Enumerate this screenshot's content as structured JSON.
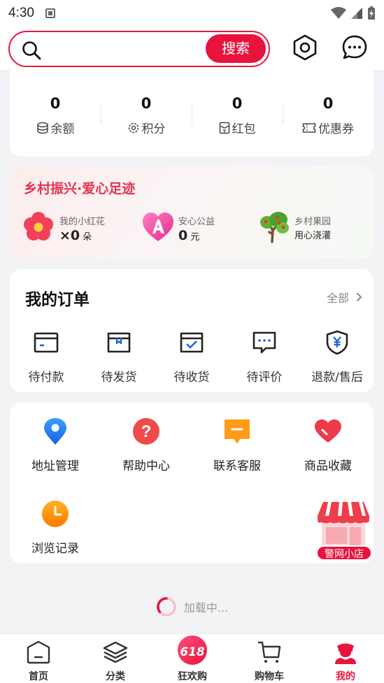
{
  "status_bar": {
    "time": "4:30"
  },
  "search": {
    "placeholder": "",
    "button_label": "搜索"
  },
  "wallet": [
    {
      "value": "0",
      "label": "余额",
      "icon": "coins-icon"
    },
    {
      "value": "0",
      "label": "积分",
      "icon": "points-gear-icon"
    },
    {
      "value": "0",
      "label": "红包",
      "icon": "red-packet-icon"
    },
    {
      "value": "0",
      "label": "优惠券",
      "icon": "coupon-icon"
    }
  ],
  "rural": {
    "title": "乡村振兴·爱心足迹",
    "items": [
      {
        "title": "我的小红花",
        "prefix": "×",
        "value": "0",
        "unit": "朵",
        "icon": "red-flower-icon"
      },
      {
        "title": "安心公益",
        "prefix": "",
        "value": "0",
        "unit": "元",
        "icon": "heart-a-icon"
      },
      {
        "title": "乡村果园",
        "prefix": "",
        "value": "",
        "unit": "用心浇灌",
        "icon": "fruit-tree-icon"
      }
    ]
  },
  "orders": {
    "title": "我的订单",
    "all_label": "全部",
    "items": [
      {
        "label": "待付款",
        "icon": "wallet-card-icon"
      },
      {
        "label": "待发货",
        "icon": "box-icon"
      },
      {
        "label": "待收货",
        "icon": "box-check-icon"
      },
      {
        "label": "待评价",
        "icon": "comment-icon"
      },
      {
        "label": "退款/售后",
        "icon": "shield-yen-icon"
      }
    ]
  },
  "services": {
    "items": [
      {
        "label": "地址管理",
        "icon": "location-pin-icon"
      },
      {
        "label": "帮助中心",
        "icon": "help-icon"
      },
      {
        "label": "联系客服",
        "icon": "chat-service-icon"
      },
      {
        "label": "商品收藏",
        "icon": "heart-favorite-icon"
      },
      {
        "label": "浏览记录",
        "icon": "clock-icon"
      }
    ],
    "shop_label": "警网小店"
  },
  "loading_text": "加载中...",
  "tabs": [
    {
      "label": "首页",
      "icon": "home-icon",
      "active": false
    },
    {
      "label": "分类",
      "icon": "layers-icon",
      "active": false
    },
    {
      "label": "狂欢购",
      "icon": "promo-618-icon",
      "badge": "618",
      "active": false
    },
    {
      "label": "购物车",
      "icon": "cart-icon",
      "active": false
    },
    {
      "label": "我的",
      "icon": "user-police-icon",
      "active": true
    }
  ],
  "colors": {
    "accent": "#e8143e",
    "rural_title": "#e23552"
  }
}
